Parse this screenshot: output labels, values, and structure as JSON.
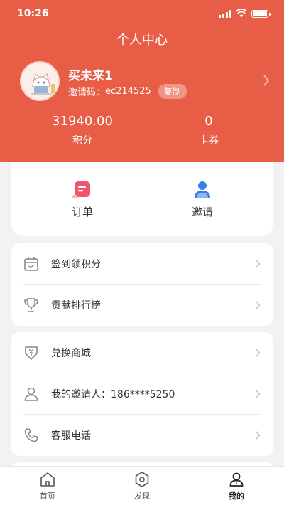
{
  "status_bar": {
    "time": "10:26"
  },
  "header": {
    "title": "个人中心",
    "user_name": "买未来1",
    "invite_label": "邀请码：",
    "invite_code": "ec214525",
    "copy_label": "复制"
  },
  "stats": [
    {
      "value": "31940.00",
      "label": "积分"
    },
    {
      "value": "0",
      "label": "卡券"
    }
  ],
  "quick_actions": [
    {
      "label": "订单",
      "icon": "order-icon"
    },
    {
      "label": "邀请",
      "icon": "invite-user-icon"
    }
  ],
  "menu_group_1": [
    {
      "label": "签到领积分",
      "icon": "calendar-check-icon"
    },
    {
      "label": "贡献排行榜",
      "icon": "trophy-icon"
    }
  ],
  "menu_group_2": [
    {
      "label": "兑换商城",
      "icon": "exchange-mall-icon"
    },
    {
      "label": "我的邀请人：186****5250",
      "icon": "person-icon"
    },
    {
      "label": "客服电话",
      "icon": "phone-icon"
    }
  ],
  "tabbar": [
    {
      "label": "首页",
      "icon": "home-icon"
    },
    {
      "label": "发现",
      "icon": "discover-icon"
    },
    {
      "label": "我的",
      "icon": "profile-icon"
    }
  ],
  "colors": {
    "brand": "#e75d45",
    "order_icon": "#f0556a",
    "invite_icon": "#3b7ee8"
  }
}
